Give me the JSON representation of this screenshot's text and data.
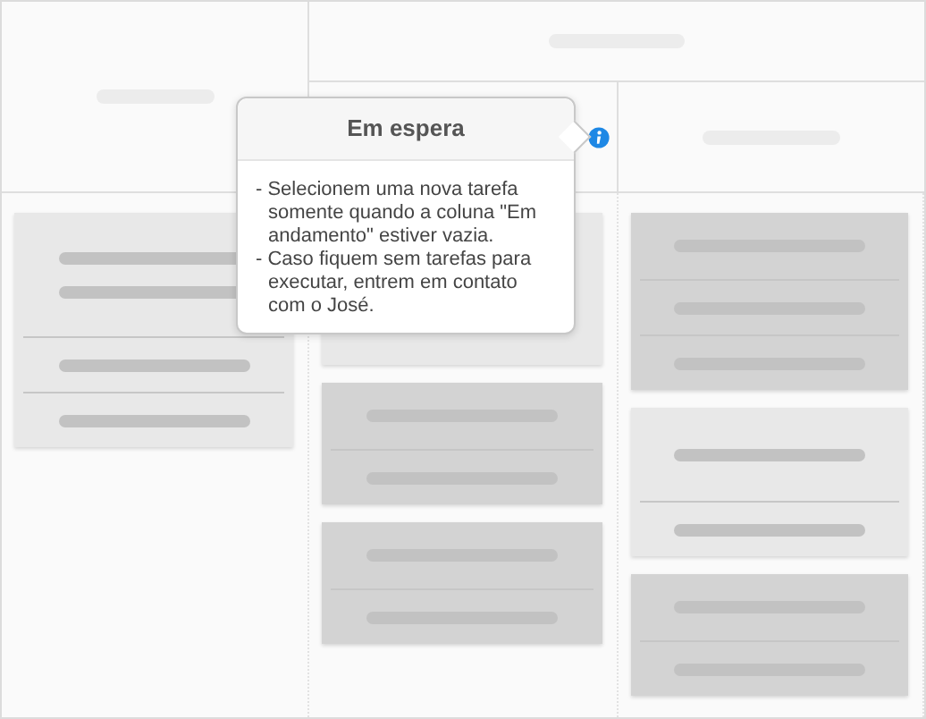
{
  "popover": {
    "title": "Em espera",
    "lines": [
      "- Selecionem uma nova tarefa somente quando a coluna \"Em andamento\" estiver vazia.",
      "- Caso fiquem sem tarefas para executar, entrem em contato com o José."
    ]
  },
  "columns": [
    {
      "cards": [
        {
          "kind": "light",
          "sections": [
            {
              "kind": "double"
            },
            {
              "kind": "single"
            },
            {
              "kind": "single"
            }
          ]
        }
      ]
    },
    {
      "cards": [
        {
          "kind": "light",
          "sections": [
            {
              "kind": "blank"
            }
          ]
        },
        {
          "kind": "dark",
          "sections": [
            {
              "kind": "top"
            },
            {
              "kind": "single"
            }
          ]
        },
        {
          "kind": "dark",
          "sections": [
            {
              "kind": "top"
            },
            {
              "kind": "single"
            }
          ]
        }
      ]
    },
    {
      "cards": [
        {
          "kind": "dark",
          "sections": [
            {
              "kind": "top"
            },
            {
              "kind": "single"
            },
            {
              "kind": "single"
            }
          ]
        },
        {
          "kind": "light",
          "sections": [
            {
              "kind": "wide"
            },
            {
              "kind": "single"
            }
          ]
        },
        {
          "kind": "dark",
          "sections": [
            {
              "kind": "top"
            },
            {
              "kind": "single"
            }
          ]
        }
      ]
    }
  ]
}
